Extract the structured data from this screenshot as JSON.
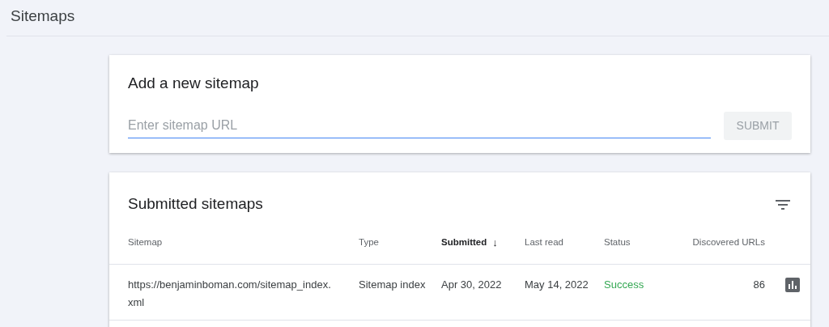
{
  "header": {
    "title": "Sitemaps"
  },
  "add_card": {
    "title": "Add a new sitemap",
    "field": {
      "placeholder": "Enter sitemap URL",
      "focused": true
    },
    "submit": {
      "label": "SUBMIT",
      "disabled": true
    }
  },
  "submitted_card": {
    "title": "Submitted sitemaps",
    "columns": [
      {
        "label": "Sitemap",
        "sorted": false
      },
      {
        "label": "Type",
        "sorted": false
      },
      {
        "label": "Submitted",
        "sorted": true,
        "sort_arrow": "↓"
      },
      {
        "label": "Last read",
        "sorted": false
      },
      {
        "label": "Status",
        "sorted": false
      },
      {
        "label": "Discovered URLs",
        "sorted": false
      }
    ],
    "rows": [
      {
        "sitemap": "https://benjaminboman.com/sitemap_index.xml",
        "type": "Sitemap index",
        "submitted": "Apr 30, 2022",
        "last_read": "May 14, 2022",
        "status": {
          "text": "Success",
          "kind": "success"
        },
        "discovered_urls": "86"
      }
    ]
  }
}
